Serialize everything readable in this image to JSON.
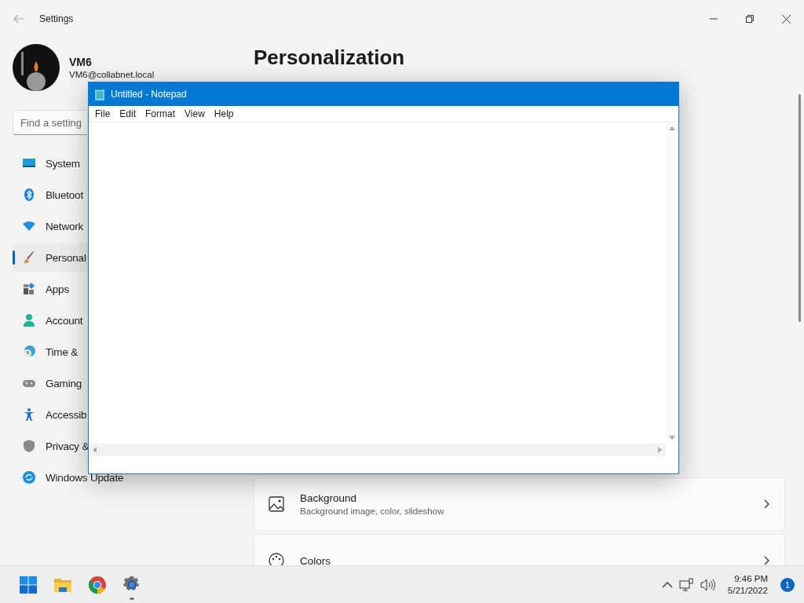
{
  "window": {
    "title": "Settings"
  },
  "account": {
    "name": "VM6",
    "email": "VM6@collabnet.local"
  },
  "search": {
    "placeholder": "Find a setting"
  },
  "sidebar": {
    "items": [
      {
        "label": "System",
        "selected": false
      },
      {
        "label": "Bluetoot",
        "selected": false
      },
      {
        "label": "Network",
        "selected": false
      },
      {
        "label": "Personal",
        "selected": true
      },
      {
        "label": "Apps",
        "selected": false
      },
      {
        "label": "Account",
        "selected": false
      },
      {
        "label": "Time &",
        "selected": false
      },
      {
        "label": "Gaming",
        "selected": false
      },
      {
        "label": "Accessib",
        "selected": false
      },
      {
        "label": "Privacy &",
        "selected": false
      },
      {
        "label": "Windows Update",
        "selected": false
      }
    ]
  },
  "page": {
    "title": "Personalization",
    "cards": [
      {
        "title": "Background",
        "subtitle": "Background image, color, slideshow"
      },
      {
        "title": "Colors"
      }
    ]
  },
  "notepad": {
    "title": "Untitled - Notepad",
    "menu": [
      "File",
      "Edit",
      "Format",
      "View",
      "Help"
    ]
  },
  "taskbar": {
    "apps": [
      {
        "selected": false
      },
      {
        "selected": false
      },
      {
        "selected": false
      },
      {
        "selected": true
      }
    ],
    "time": "9:46 PM",
    "date": "5/21/2022",
    "notifications": "1"
  }
}
